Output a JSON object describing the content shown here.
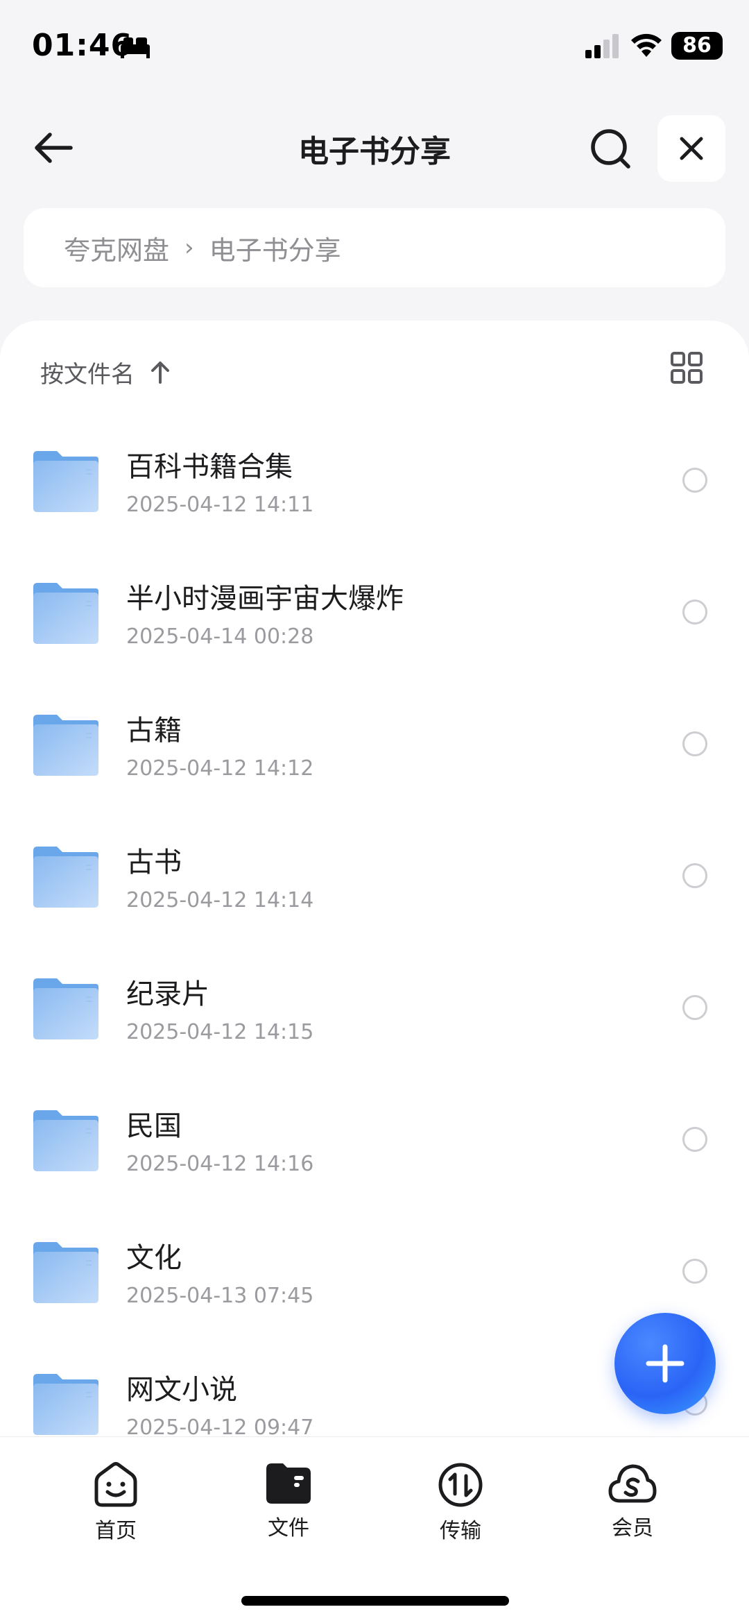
{
  "status_bar": {
    "time": "01:46",
    "battery": "86"
  },
  "header": {
    "title": "电子书分享"
  },
  "breadcrumb": {
    "root": "夸克网盘",
    "current": "电子书分享"
  },
  "sort": {
    "label": "按文件名"
  },
  "files": [
    {
      "name": "百科书籍合集",
      "date": "2025-04-12 14:11"
    },
    {
      "name": "半小时漫画宇宙大爆炸",
      "date": "2025-04-14 00:28"
    },
    {
      "name": "古籍",
      "date": "2025-04-12 14:12"
    },
    {
      "name": "古书",
      "date": "2025-04-12 14:14"
    },
    {
      "name": "纪录片",
      "date": "2025-04-12 14:15"
    },
    {
      "name": "民国",
      "date": "2025-04-12 14:16"
    },
    {
      "name": "文化",
      "date": "2025-04-13 07:45"
    },
    {
      "name": "网文小说",
      "date": "2025-04-12 09:47"
    }
  ],
  "tabs": [
    {
      "label": "首页",
      "icon": "home-face-icon"
    },
    {
      "label": "文件",
      "icon": "folder-icon"
    },
    {
      "label": "传输",
      "icon": "transfer-icon"
    },
    {
      "label": "会员",
      "icon": "cloud-vip-icon"
    }
  ],
  "colors": {
    "accent": "#2a64f6",
    "folder": "#8fbdf3",
    "background": "#f5f5f7"
  }
}
